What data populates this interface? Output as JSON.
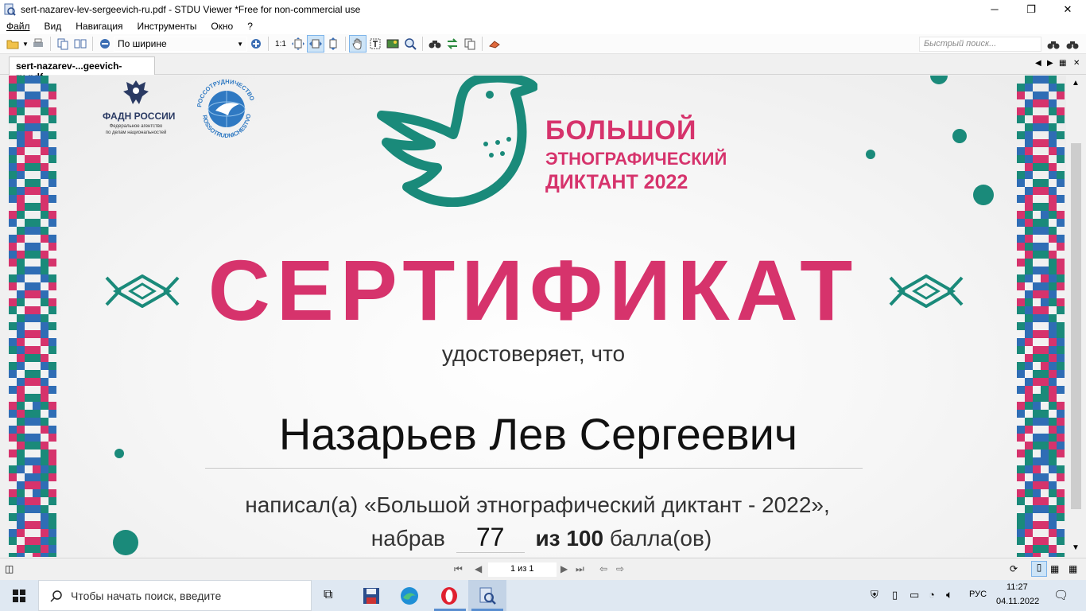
{
  "window": {
    "title": "sert-nazarev-lev-sergeevich-ru.pdf - STDU Viewer *Free for non-commercial use",
    "controls": {
      "minimize": "─",
      "restore": "❐",
      "close": "✕"
    }
  },
  "menu": [
    "Файл",
    "Вид",
    "Навигация",
    "Инструменты",
    "Окно",
    "?"
  ],
  "toolbar": {
    "zoom_mode": "По ширине",
    "actual_size": "1:1",
    "search_placeholder": "Быстрый поиск..."
  },
  "tab": {
    "label": "sert-nazarev-...geevich-ru.pdf"
  },
  "document": {
    "logo_fadn_title": "ФАДН РОССИИ",
    "logo_fadn_sub1": "Федеральное агентство",
    "logo_fadn_sub2": "по делам национальностей",
    "logo_rs_top": "РОССОТРУДНИЧЕСТВО",
    "logo_rs_bottom": "ROSSOTRUDNICHESTVO",
    "brand_line1": "БОЛЬШОЙ",
    "brand_line2": "ЭТНОГРАФИЧЕСКИЙ",
    "brand_line3": "ДИКТАНТ 2022",
    "heading": "СЕРТИФИКАТ",
    "certifies": "удостоверяет, что",
    "name": "Назарьев Лев Сергеевич",
    "line1": "написал(а) «Большой этнографический диктант - 2022»,",
    "score_prefix": "набрав",
    "score": "77",
    "score_of": "из 100",
    "score_suffix": "балла(ов)"
  },
  "colors": {
    "pink": "#d6336c",
    "teal": "#1a8a7a",
    "blue": "#2f6db5"
  },
  "status": {
    "page_indicator": "1 из 1"
  },
  "taskbar": {
    "search_placeholder": "Чтобы начать поиск, введите",
    "lang": "РУС",
    "time": "11:27",
    "date": "04.11.2022"
  }
}
